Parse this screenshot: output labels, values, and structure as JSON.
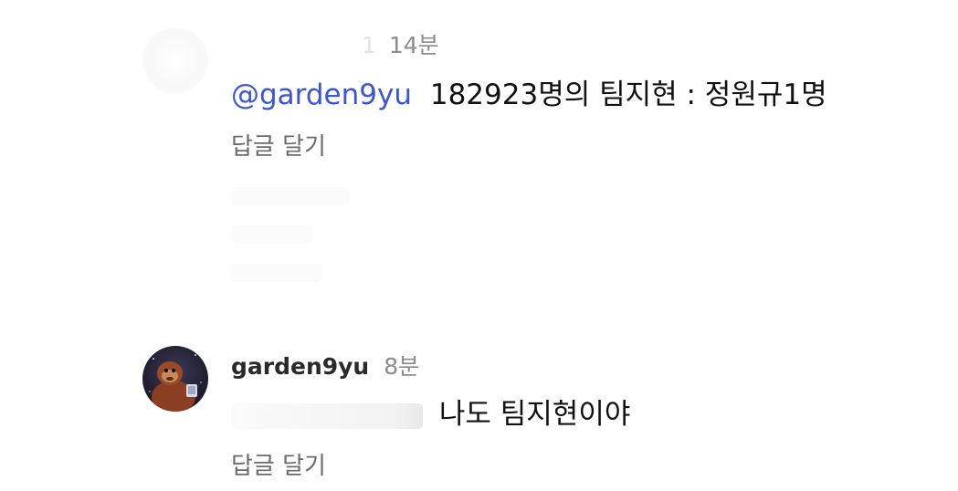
{
  "comments": [
    {
      "time": "14분",
      "mention": "@garden9yu",
      "text": "182923명의 팀지현 : 정원규1명",
      "reply_label": "답글 달기"
    },
    {
      "username": "garden9yu",
      "time": "8분",
      "text": "나도 팀지현이야",
      "reply_label": "답글 달기"
    }
  ]
}
